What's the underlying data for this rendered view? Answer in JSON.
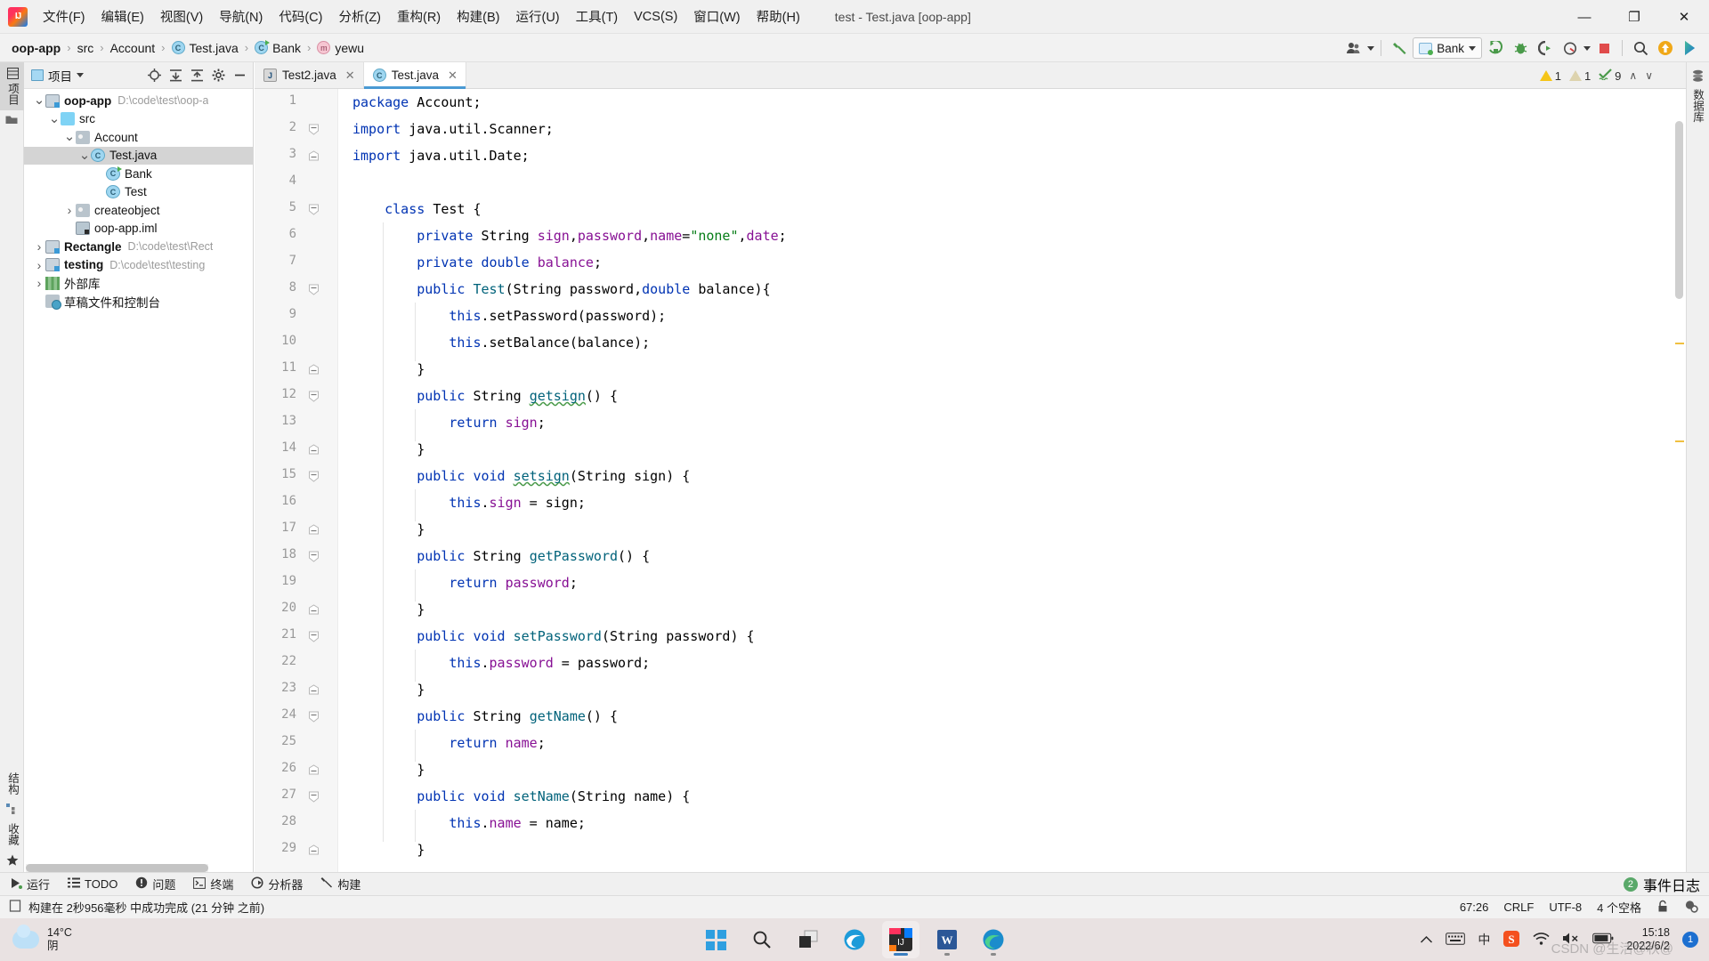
{
  "window": {
    "title": "test - Test.java [oop-app]",
    "minimize": "—",
    "maximize": "❐",
    "close": "✕"
  },
  "menu": {
    "items": [
      {
        "label": "文件(F)",
        "name": "menu-file"
      },
      {
        "label": "编辑(E)",
        "name": "menu-edit"
      },
      {
        "label": "视图(V)",
        "name": "menu-view"
      },
      {
        "label": "导航(N)",
        "name": "menu-navigate"
      },
      {
        "label": "代码(C)",
        "name": "menu-code"
      },
      {
        "label": "分析(Z)",
        "name": "menu-analyze"
      },
      {
        "label": "重构(R)",
        "name": "menu-refactor"
      },
      {
        "label": "构建(B)",
        "name": "menu-build"
      },
      {
        "label": "运行(U)",
        "name": "menu-run"
      },
      {
        "label": "工具(T)",
        "name": "menu-tools"
      },
      {
        "label": "VCS(S)",
        "name": "menu-vcs"
      },
      {
        "label": "窗口(W)",
        "name": "menu-window"
      },
      {
        "label": "帮助(H)",
        "name": "menu-help"
      }
    ]
  },
  "breadcrumbs": [
    {
      "label": "oop-app",
      "icon": "none",
      "bold": true
    },
    {
      "label": "src",
      "icon": "none",
      "bold": false
    },
    {
      "label": "Account",
      "icon": "none",
      "bold": false
    },
    {
      "label": "Test.java",
      "icon": "class",
      "bold": false
    },
    {
      "label": "Bank",
      "icon": "class-green",
      "bold": false
    },
    {
      "label": "yewu",
      "icon": "method",
      "bold": false
    }
  ],
  "toolbar": {
    "run_config_label": "Bank",
    "icons": [
      {
        "name": "account-icon",
        "glyph": "♟"
      },
      {
        "name": "build-hammer-icon",
        "glyph": "⚒"
      },
      {
        "name": "run-icon",
        "glyph": "▶"
      },
      {
        "name": "debug-icon",
        "glyph": "⚒"
      },
      {
        "name": "run-with-coverage-icon",
        "glyph": "▶"
      },
      {
        "name": "profile-icon",
        "glyph": "⏱"
      },
      {
        "name": "stop-icon",
        "glyph": "■"
      },
      {
        "name": "search-everywhere-icon",
        "glyph": "⌕"
      },
      {
        "name": "update-project-icon",
        "glyph": "↑"
      },
      {
        "name": "ide-assistant-icon",
        "glyph": "▶"
      }
    ]
  },
  "left_strip": {
    "top": [
      {
        "label": "项目",
        "name": "vertical-tab-project",
        "active": true
      },
      {
        "label": "",
        "name": "vertical-tab-commit",
        "active": false
      }
    ],
    "bottom": [
      {
        "label": "结构",
        "name": "vertical-tab-structure",
        "active": false
      },
      {
        "label": "收藏",
        "name": "vertical-tab-favorites",
        "active": false
      }
    ]
  },
  "right_strip": {
    "items": [
      {
        "label": "数据库",
        "name": "vertical-tab-database"
      }
    ]
  },
  "project_panel": {
    "title": "项目",
    "header_icons": [
      {
        "name": "locate-icon",
        "glyph": "⊕"
      },
      {
        "name": "expand-all-icon",
        "glyph": "⤓"
      },
      {
        "name": "collapse-all-icon",
        "glyph": "⤒"
      },
      {
        "name": "settings-gear-icon",
        "glyph": "⚙"
      },
      {
        "name": "hide-panel-icon",
        "glyph": "—"
      }
    ],
    "tree": [
      {
        "label": "oop-app",
        "path": "D:\\code\\test\\oop-a",
        "indent": 0,
        "arrow": "down",
        "icon": "module",
        "bold": true,
        "selected": false
      },
      {
        "label": "src",
        "path": "",
        "indent": 1,
        "arrow": "down",
        "icon": "folder",
        "bold": false,
        "selected": false
      },
      {
        "label": "Account",
        "path": "",
        "indent": 2,
        "arrow": "down",
        "icon": "pkg",
        "bold": false,
        "selected": false
      },
      {
        "label": "Test.java",
        "path": "",
        "indent": 3,
        "arrow": "down",
        "icon": "class",
        "bold": false,
        "selected": true
      },
      {
        "label": "Bank",
        "path": "",
        "indent": 4,
        "arrow": "none",
        "icon": "class-run",
        "bold": false,
        "selected": false
      },
      {
        "label": "Test",
        "path": "",
        "indent": 4,
        "arrow": "none",
        "icon": "class",
        "bold": false,
        "selected": false
      },
      {
        "label": "createobject",
        "path": "",
        "indent": 2,
        "arrow": "right",
        "icon": "pkg",
        "bold": false,
        "selected": false
      },
      {
        "label": "oop-app.iml",
        "path": "",
        "indent": 2,
        "arrow": "none",
        "icon": "iml",
        "bold": false,
        "selected": false
      },
      {
        "label": "Rectangle",
        "path": "D:\\code\\test\\Rect",
        "indent": 0,
        "arrow": "right",
        "icon": "module",
        "bold": true,
        "selected": false
      },
      {
        "label": "testing",
        "path": "D:\\code\\test\\testing",
        "indent": 0,
        "arrow": "right",
        "icon": "module",
        "bold": true,
        "selected": false
      },
      {
        "label": "外部库",
        "path": "",
        "indent": 0,
        "arrow": "right",
        "icon": "lib",
        "bold": false,
        "selected": false
      },
      {
        "label": "草稿文件和控制台",
        "path": "",
        "indent": 0,
        "arrow": "none",
        "icon": "scratch",
        "bold": false,
        "selected": false
      }
    ]
  },
  "editor": {
    "tabs": [
      {
        "label": "Test2.java",
        "icon": "java-file",
        "active": false
      },
      {
        "label": "Test.java",
        "icon": "class",
        "active": true
      }
    ],
    "inspection": {
      "warnings": "1",
      "weak_warnings": "1",
      "typos": "9",
      "up_arrow": "∧",
      "down_arrow": "∨"
    },
    "lines": [
      {
        "n": 1,
        "fold": "none",
        "tokens": [
          {
            "t": "package ",
            "c": "k"
          },
          {
            "t": "Account;",
            "c": "t"
          }
        ]
      },
      {
        "n": 2,
        "fold": "open",
        "tokens": [
          {
            "t": "import ",
            "c": "k"
          },
          {
            "t": "java.util.Scanner;",
            "c": "t"
          }
        ]
      },
      {
        "n": 3,
        "fold": "end",
        "tokens": [
          {
            "t": "import ",
            "c": "k"
          },
          {
            "t": "java.util.Date;",
            "c": "t"
          }
        ]
      },
      {
        "n": 4,
        "fold": "none",
        "tokens": []
      },
      {
        "n": 5,
        "fold": "open",
        "indent": 1,
        "tokens": [
          {
            "t": "class ",
            "c": "k"
          },
          {
            "t": "Test {",
            "c": "t"
          }
        ]
      },
      {
        "n": 6,
        "fold": "none",
        "indent": 2,
        "tokens": [
          {
            "t": "private ",
            "c": "k"
          },
          {
            "t": "String ",
            "c": "t"
          },
          {
            "t": "sign",
            "c": "f"
          },
          {
            "t": ",",
            "c": "t"
          },
          {
            "t": "password",
            "c": "f"
          },
          {
            "t": ",",
            "c": "t"
          },
          {
            "t": "name",
            "c": "f"
          },
          {
            "t": "=",
            "c": "t"
          },
          {
            "t": "\"none\"",
            "c": "s"
          },
          {
            "t": ",",
            "c": "t"
          },
          {
            "t": "date",
            "c": "f"
          },
          {
            "t": ";",
            "c": "t"
          }
        ]
      },
      {
        "n": 7,
        "fold": "none",
        "indent": 2,
        "tokens": [
          {
            "t": "private ",
            "c": "k"
          },
          {
            "t": "double ",
            "c": "k"
          },
          {
            "t": "balance",
            "c": "f"
          },
          {
            "t": ";",
            "c": "t"
          }
        ]
      },
      {
        "n": 8,
        "fold": "open",
        "indent": 2,
        "tokens": [
          {
            "t": "public ",
            "c": "k"
          },
          {
            "t": "Test",
            "c": "m"
          },
          {
            "t": "(String password,",
            "c": "t"
          },
          {
            "t": "double ",
            "c": "k"
          },
          {
            "t": "balance){",
            "c": "t"
          }
        ]
      },
      {
        "n": 9,
        "fold": "none",
        "indent": 3,
        "tokens": [
          {
            "t": "this",
            "c": "k"
          },
          {
            "t": ".setPassword(password);",
            "c": "t"
          }
        ]
      },
      {
        "n": 10,
        "fold": "none",
        "indent": 3,
        "tokens": [
          {
            "t": "this",
            "c": "k"
          },
          {
            "t": ".setBalance(balance);",
            "c": "t"
          }
        ]
      },
      {
        "n": 11,
        "fold": "end",
        "indent": 2,
        "tokens": [
          {
            "t": "}",
            "c": "t"
          }
        ]
      },
      {
        "n": 12,
        "fold": "open",
        "indent": 2,
        "tokens": [
          {
            "t": "public ",
            "c": "k"
          },
          {
            "t": "String ",
            "c": "t"
          },
          {
            "t": "getsign",
            "c": "m typo"
          },
          {
            "t": "() {",
            "c": "t"
          }
        ]
      },
      {
        "n": 13,
        "fold": "none",
        "indent": 3,
        "tokens": [
          {
            "t": "return ",
            "c": "k"
          },
          {
            "t": "sign",
            "c": "f"
          },
          {
            "t": ";",
            "c": "t"
          }
        ]
      },
      {
        "n": 14,
        "fold": "end",
        "indent": 2,
        "tokens": [
          {
            "t": "}",
            "c": "t"
          }
        ]
      },
      {
        "n": 15,
        "fold": "open",
        "indent": 2,
        "tokens": [
          {
            "t": "public ",
            "c": "k"
          },
          {
            "t": "void ",
            "c": "k"
          },
          {
            "t": "setsign",
            "c": "m typo"
          },
          {
            "t": "(String sign) {",
            "c": "t"
          }
        ]
      },
      {
        "n": 16,
        "fold": "none",
        "indent": 3,
        "tokens": [
          {
            "t": "this",
            "c": "k"
          },
          {
            "t": ".",
            "c": "t"
          },
          {
            "t": "sign",
            "c": "f"
          },
          {
            "t": " = sign;",
            "c": "t"
          }
        ]
      },
      {
        "n": 17,
        "fold": "end",
        "indent": 2,
        "tokens": [
          {
            "t": "}",
            "c": "t"
          }
        ]
      },
      {
        "n": 18,
        "fold": "open",
        "indent": 2,
        "tokens": [
          {
            "t": "public ",
            "c": "k"
          },
          {
            "t": "String ",
            "c": "t"
          },
          {
            "t": "getPassword",
            "c": "m"
          },
          {
            "t": "() {",
            "c": "t"
          }
        ]
      },
      {
        "n": 19,
        "fold": "none",
        "indent": 3,
        "tokens": [
          {
            "t": "return ",
            "c": "k"
          },
          {
            "t": "password",
            "c": "f"
          },
          {
            "t": ";",
            "c": "t"
          }
        ]
      },
      {
        "n": 20,
        "fold": "end",
        "indent": 2,
        "tokens": [
          {
            "t": "}",
            "c": "t"
          }
        ]
      },
      {
        "n": 21,
        "fold": "open",
        "indent": 2,
        "tokens": [
          {
            "t": "public ",
            "c": "k"
          },
          {
            "t": "void ",
            "c": "k"
          },
          {
            "t": "setPassword",
            "c": "m"
          },
          {
            "t": "(String password) {",
            "c": "t"
          }
        ]
      },
      {
        "n": 22,
        "fold": "none",
        "indent": 3,
        "tokens": [
          {
            "t": "this",
            "c": "k"
          },
          {
            "t": ".",
            "c": "t"
          },
          {
            "t": "password",
            "c": "f"
          },
          {
            "t": " = password;",
            "c": "t"
          }
        ]
      },
      {
        "n": 23,
        "fold": "end",
        "indent": 2,
        "tokens": [
          {
            "t": "}",
            "c": "t"
          }
        ]
      },
      {
        "n": 24,
        "fold": "open",
        "indent": 2,
        "tokens": [
          {
            "t": "public ",
            "c": "k"
          },
          {
            "t": "String ",
            "c": "t"
          },
          {
            "t": "getName",
            "c": "m"
          },
          {
            "t": "() {",
            "c": "t"
          }
        ]
      },
      {
        "n": 25,
        "fold": "none",
        "indent": 3,
        "tokens": [
          {
            "t": "return ",
            "c": "k"
          },
          {
            "t": "name",
            "c": "f"
          },
          {
            "t": ";",
            "c": "t"
          }
        ]
      },
      {
        "n": 26,
        "fold": "end",
        "indent": 2,
        "tokens": [
          {
            "t": "}",
            "c": "t"
          }
        ]
      },
      {
        "n": 27,
        "fold": "open",
        "indent": 2,
        "tokens": [
          {
            "t": "public ",
            "c": "k"
          },
          {
            "t": "void ",
            "c": "k"
          },
          {
            "t": "setName",
            "c": "m"
          },
          {
            "t": "(String name) {",
            "c": "t"
          }
        ]
      },
      {
        "n": 28,
        "fold": "none",
        "indent": 3,
        "tokens": [
          {
            "t": "this",
            "c": "k"
          },
          {
            "t": ".",
            "c": "t"
          },
          {
            "t": "name",
            "c": "f"
          },
          {
            "t": " = name;",
            "c": "t"
          }
        ]
      },
      {
        "n": 29,
        "fold": "end",
        "indent": 2,
        "tokens": [
          {
            "t": "}",
            "c": "t"
          }
        ]
      }
    ]
  },
  "bottom_bar": {
    "buttons": [
      {
        "label": "运行",
        "name": "tool-window-run",
        "glyph": "▶"
      },
      {
        "label": "TODO",
        "name": "tool-window-todo",
        "glyph": "☰"
      },
      {
        "label": "问题",
        "name": "tool-window-problems",
        "glyph": "❗"
      },
      {
        "label": "终端",
        "name": "tool-window-terminal",
        "glyph": "⌨"
      },
      {
        "label": "分析器",
        "name": "tool-window-profiler",
        "glyph": "◔"
      },
      {
        "label": "构建",
        "name": "tool-window-build",
        "glyph": "⚒"
      }
    ],
    "event_log": {
      "label": "事件日志",
      "count": "2"
    }
  },
  "status_bar": {
    "message": "构建在 2秒956毫秒 中成功完成 (21 分钟 之前)",
    "caret": "67:26",
    "line_sep": "CRLF",
    "encoding": "UTF-8",
    "indent": "4 个空格",
    "lock_icon": "⚿",
    "inspection_icon": "⚙"
  },
  "taskbar": {
    "weather": {
      "temp": "14°C",
      "desc": "阴"
    },
    "apps": [
      {
        "name": "start-button",
        "label": "Start"
      },
      {
        "name": "search-button",
        "label": "Search"
      },
      {
        "name": "task-view-button",
        "label": "Task View"
      },
      {
        "name": "edge-beta-app",
        "label": "Edge Beta"
      },
      {
        "name": "intellij-idea-app",
        "label": "IntelliJ IDEA"
      },
      {
        "name": "word-app",
        "label": "Word"
      },
      {
        "name": "edge-app",
        "label": "Edge"
      }
    ],
    "tray": [
      {
        "name": "show-hidden-icons",
        "glyph": "∧"
      },
      {
        "name": "touch-keyboard-icon",
        "glyph": "⌨"
      },
      {
        "name": "ime-icon",
        "glyph": "中"
      },
      {
        "name": "sogou-input-icon",
        "glyph": "S"
      },
      {
        "name": "wifi-icon",
        "glyph": "◠"
      },
      {
        "name": "volume-muted-icon",
        "glyph": "🔇"
      },
      {
        "name": "battery-icon",
        "glyph": "▬"
      }
    ],
    "clock": {
      "time": "15:18",
      "date": "2022/6/2"
    },
    "notification_count": "1",
    "watermark": "CSDN @生活@秋@"
  },
  "colors": {
    "accent": "#4a9ad4",
    "keyword": "#0033b3",
    "field": "#871094",
    "method": "#00627a",
    "string": "#067d17",
    "warning": "#f5c518",
    "ok_green": "#59a869"
  }
}
